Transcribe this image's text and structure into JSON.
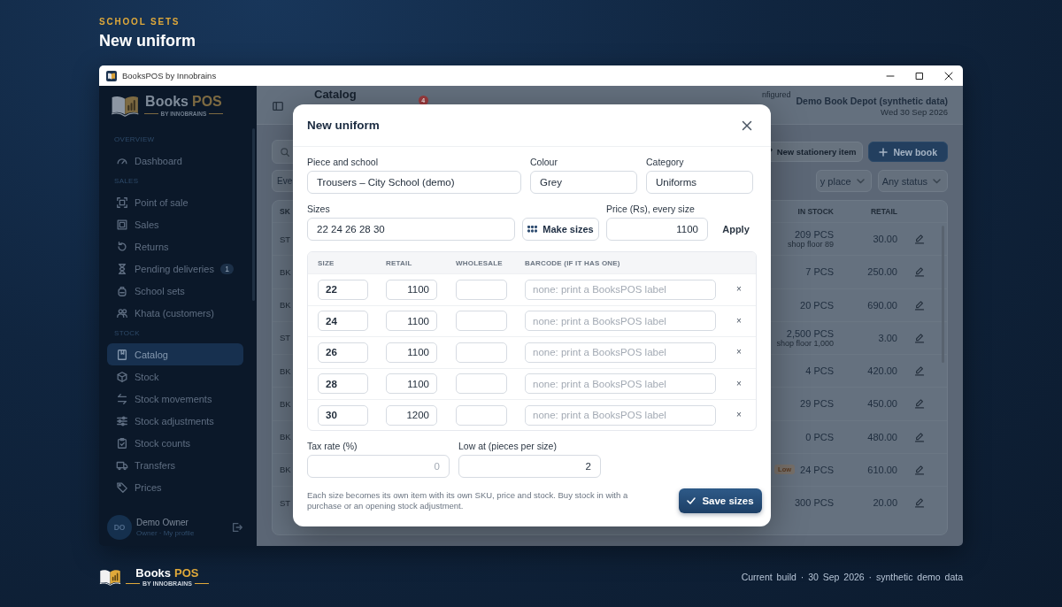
{
  "hero": {
    "eyebrow": "SCHOOL SETS",
    "title": "New uniform"
  },
  "window": {
    "title": "BooksPOS by Innobrains"
  },
  "sidebar": {
    "logo": {
      "word": "Books",
      "accent": "POS",
      "tagline": "BY INNOBRAINS"
    },
    "sections": [
      {
        "label": "OVERVIEW",
        "items": [
          {
            "label": "Dashboard",
            "selected": false
          }
        ]
      },
      {
        "label": "SALES",
        "items": [
          {
            "label": "Point of sale",
            "selected": false
          },
          {
            "label": "Sales",
            "selected": false
          },
          {
            "label": "Returns",
            "selected": false
          },
          {
            "label": "Pending deliveries",
            "badge": "1",
            "selected": false
          },
          {
            "label": "School sets",
            "selected": false
          },
          {
            "label": "Khata (customers)",
            "selected": false
          }
        ]
      },
      {
        "label": "STOCK",
        "items": [
          {
            "label": "Catalog",
            "selected": true
          },
          {
            "label": "Stock",
            "selected": false
          },
          {
            "label": "Stock movements",
            "selected": false
          },
          {
            "label": "Stock adjustments",
            "selected": false
          },
          {
            "label": "Stock counts",
            "selected": false
          },
          {
            "label": "Transfers",
            "selected": false
          },
          {
            "label": "Prices",
            "selected": false
          }
        ]
      }
    ],
    "user": {
      "initials": "DO",
      "name": "Demo Owner",
      "role": "Owner · My profile"
    }
  },
  "main": {
    "header": {
      "title": "Catalog",
      "notification_count": "4",
      "status_tail": "nfigured",
      "shop": "Demo Book Depot (synthetic data)",
      "date": "Wed 30 Sep 2026"
    },
    "actions": [
      {
        "label": "New stationery item",
        "kind": "secondary"
      },
      {
        "label": "New book",
        "kind": "primary"
      }
    ],
    "filters": [
      {
        "value": "Eve",
        "kind": "left"
      },
      {
        "value": "y place",
        "kind": "right"
      },
      {
        "value": "Any status",
        "kind": "right"
      }
    ],
    "table": {
      "columns": [
        "SK",
        "IN STOCK",
        "RETAIL"
      ],
      "rows": [
        {
          "sku": "ST",
          "stock": "209 PCS",
          "note": "shop floor 89",
          "retail": "30.00"
        },
        {
          "sku": "BK",
          "stock": "7 PCS",
          "retail": "250.00"
        },
        {
          "sku": "BK",
          "stock": "20 PCS",
          "retail": "690.00"
        },
        {
          "sku": "ST",
          "stock": "2,500 PCS",
          "note": "shop floor 1,000",
          "retail": "3.00"
        },
        {
          "sku": "BK",
          "stock": "4 PCS",
          "retail": "420.00"
        },
        {
          "sku": "BK",
          "stock": "29 PCS",
          "retail": "450.00"
        },
        {
          "sku": "BK",
          "stock": "0 PCS",
          "retail": "480.00"
        },
        {
          "sku": "BK",
          "stock": "24 PCS",
          "badge": "Low",
          "retail": "610.00"
        },
        {
          "sku": "ST",
          "stock": "300 PCS",
          "retail": "20.00"
        }
      ]
    }
  },
  "dialog": {
    "title": "New uniform",
    "fields": [
      {
        "label": "Piece and school",
        "value": "Trousers – City School (demo)"
      },
      {
        "label": "Colour",
        "value": "Grey"
      },
      {
        "label": "Category",
        "value": "Uniforms"
      }
    ],
    "sizes": {
      "label": "Sizes",
      "value": "22 24 26 28 30",
      "button": "Make sizes"
    },
    "price": {
      "label": "Price (Rs), every size",
      "value": "1100",
      "button": "Apply"
    },
    "size_table": {
      "columns": [
        "SIZE",
        "RETAIL",
        "WHOLESALE",
        "BARCODE (IF IT HAS ONE)"
      ],
      "rows": [
        {
          "size": "22",
          "retail": "1100",
          "barcode_placeholder": "none: print a BooksPOS label",
          "remove": "×"
        },
        {
          "size": "24",
          "retail": "1100",
          "barcode_placeholder": "none: print a BooksPOS label",
          "remove": "×"
        },
        {
          "size": "26",
          "retail": "1100",
          "barcode_placeholder": "none: print a BooksPOS label",
          "remove": "×"
        },
        {
          "size": "28",
          "retail": "1100",
          "barcode_placeholder": "none: print a BooksPOS label",
          "remove": "×"
        },
        {
          "size": "30",
          "retail": "1200",
          "barcode_placeholder": "none: print a BooksPOS label",
          "remove": "×"
        }
      ]
    },
    "tax": {
      "label": "Tax rate (%)",
      "placeholder": "0"
    },
    "low_at": {
      "label": "Low at (pieces per size)",
      "value": "2"
    },
    "note": "Each size becomes its own item with its own SKU, price and stock. Buy stock in with a purchase or an opening stock adjustment.",
    "save_button": "Save sizes"
  },
  "footer": {
    "logo": {
      "word": "Books",
      "accent": "POS",
      "tagline": "BY INNOBRAINS"
    },
    "build": "Current build · 30 Sep 2026 · synthetic demo data"
  }
}
